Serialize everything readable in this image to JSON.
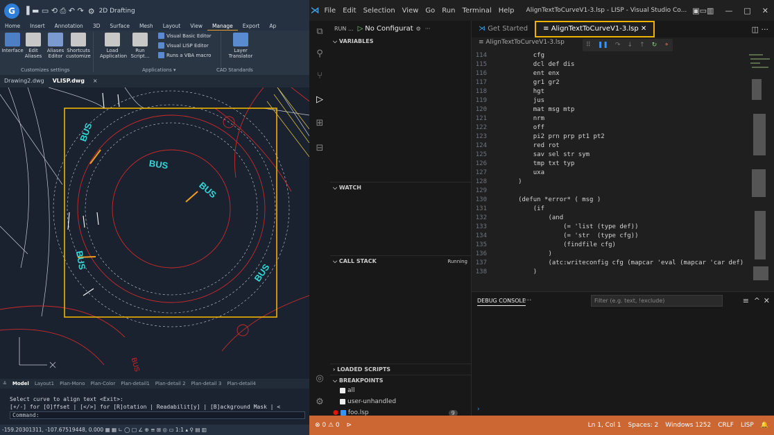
{
  "cad": {
    "title": "2D Drafting",
    "quick_access": [
      "▐",
      "▬",
      "▭",
      "⟲",
      "⎙",
      "↶",
      "↷"
    ],
    "menu": [
      "Home",
      "Insert",
      "Annotation",
      "3D",
      "Surface",
      "Mesh",
      "Layout",
      "View",
      "Manage",
      "Export",
      "Ap"
    ],
    "active_menu": "Manage",
    "ribbon": {
      "buttons": [
        {
          "label": "Interface",
          "color": "#4e7fc4"
        },
        {
          "label": "Edit Aliases",
          "color": "#c8c8c8"
        },
        {
          "label": "Aliases Editor",
          "color": "#7a9ad0"
        },
        {
          "label": "Shortcuts customize",
          "color": "#c8c8c8"
        },
        {
          "label": "Load Application",
          "color": "#c8c8c8"
        },
        {
          "label": "Run Script...",
          "color": "#c8c8c8"
        },
        {
          "label": "Layer Translator",
          "color": "#5a8ad0"
        }
      ],
      "small_buttons": [
        "Visual Basic Editor",
        "Visual LISP Editor",
        "Runs a VBA macro"
      ],
      "groups": [
        "Customizes settings",
        "Applications ▾",
        "CAD Standards"
      ]
    },
    "doc_tabs": [
      "Drawing2.dwg",
      "VLISP.dwg"
    ],
    "active_doc": "VLISP.dwg",
    "labels": [
      "BUS",
      "BUS",
      "BUS",
      "BUS",
      "BUS",
      "BUS"
    ],
    "layout_tabs": [
      "Model",
      "Layout1",
      "Plan-Mono",
      "Plan-Color",
      "Plan-detail1",
      "Plan-detail 2",
      "Plan-detail 3",
      "Plan-detail4"
    ],
    "cmd_lines": [
      "Select curve to align text <Exit>:",
      "[+/-] for [O]ffset | [</>] for [R]otation | Readabilit[y] | [B]ackground Mask | <"
    ],
    "cmd_prompt": "Command:",
    "status_coords": "-159.20301311, -107.67519448, 0.000"
  },
  "vscode": {
    "menu": [
      "File",
      "Edit",
      "Selection",
      "View",
      "Go",
      "Run",
      "Terminal",
      "Help"
    ],
    "window_title": "AlignTextToCurveV1-3.lsp - LISP - Visual Studio Co...",
    "run_label": "RUN ...",
    "run_config": "No Configurat",
    "sections": {
      "variables": "VARIABLES",
      "watch": "WATCH",
      "call_stack": "CALL STACK",
      "running": "Running",
      "loaded": "LOADED SCRIPTS",
      "breakpoints": "BREAKPOINTS"
    },
    "breakpoints": [
      "all",
      "user-unhandled",
      "foo.lsp"
    ],
    "bp_count": "9",
    "tabs": [
      "Get Started",
      "AlignTextToCurveV1-3.lsp"
    ],
    "breadcrumb": "≡ AlignTextToCurveV1-3.lsp",
    "code": [
      {
        "n": "114",
        "t": "         cfg"
      },
      {
        "n": "115",
        "t": "         dcl def dis"
      },
      {
        "n": "116",
        "t": "         ent enx"
      },
      {
        "n": "117",
        "t": "         gr1 gr2"
      },
      {
        "n": "118",
        "t": "         hgt"
      },
      {
        "n": "119",
        "t": "         jus"
      },
      {
        "n": "120",
        "t": "         mat msg mtp"
      },
      {
        "n": "121",
        "t": "         nrm"
      },
      {
        "n": "122",
        "t": "         off"
      },
      {
        "n": "123",
        "t": "         pi2 prn prp pt1 pt2"
      },
      {
        "n": "124",
        "t": "         red rot"
      },
      {
        "n": "125",
        "t": "         sav sel str sym"
      },
      {
        "n": "126",
        "t": "         tmp txt typ"
      },
      {
        "n": "127",
        "t": "         uxa"
      },
      {
        "n": "128",
        "t": "     )"
      },
      {
        "n": "129",
        "t": ""
      },
      {
        "n": "130",
        "t": "     (defun *error* ( msg )"
      },
      {
        "n": "131",
        "t": "         (if"
      },
      {
        "n": "132",
        "t": "             (and"
      },
      {
        "n": "133",
        "t": "                 (= 'list (type def))"
      },
      {
        "n": "134",
        "t": "                 (= 'str  (type cfg))"
      },
      {
        "n": "135",
        "t": "                 (findfile cfg)"
      },
      {
        "n": "136",
        "t": "             )"
      },
      {
        "n": "137",
        "t": "             (atc:writeconfig cfg (mapcar 'eval (mapcar 'car def)"
      },
      {
        "n": "138",
        "t": "         )"
      }
    ],
    "panel_tab": "DEBUG CONSOLE",
    "panel_more": "···",
    "filter_placeholder": "Filter (e.g. text, !exclude)",
    "status_left": "⊗ 0 ⚠ 0",
    "status_right": [
      "Ln 1, Col 1",
      "Spaces: 2",
      "Windows 1252",
      "CRLF",
      "LISP"
    ]
  }
}
